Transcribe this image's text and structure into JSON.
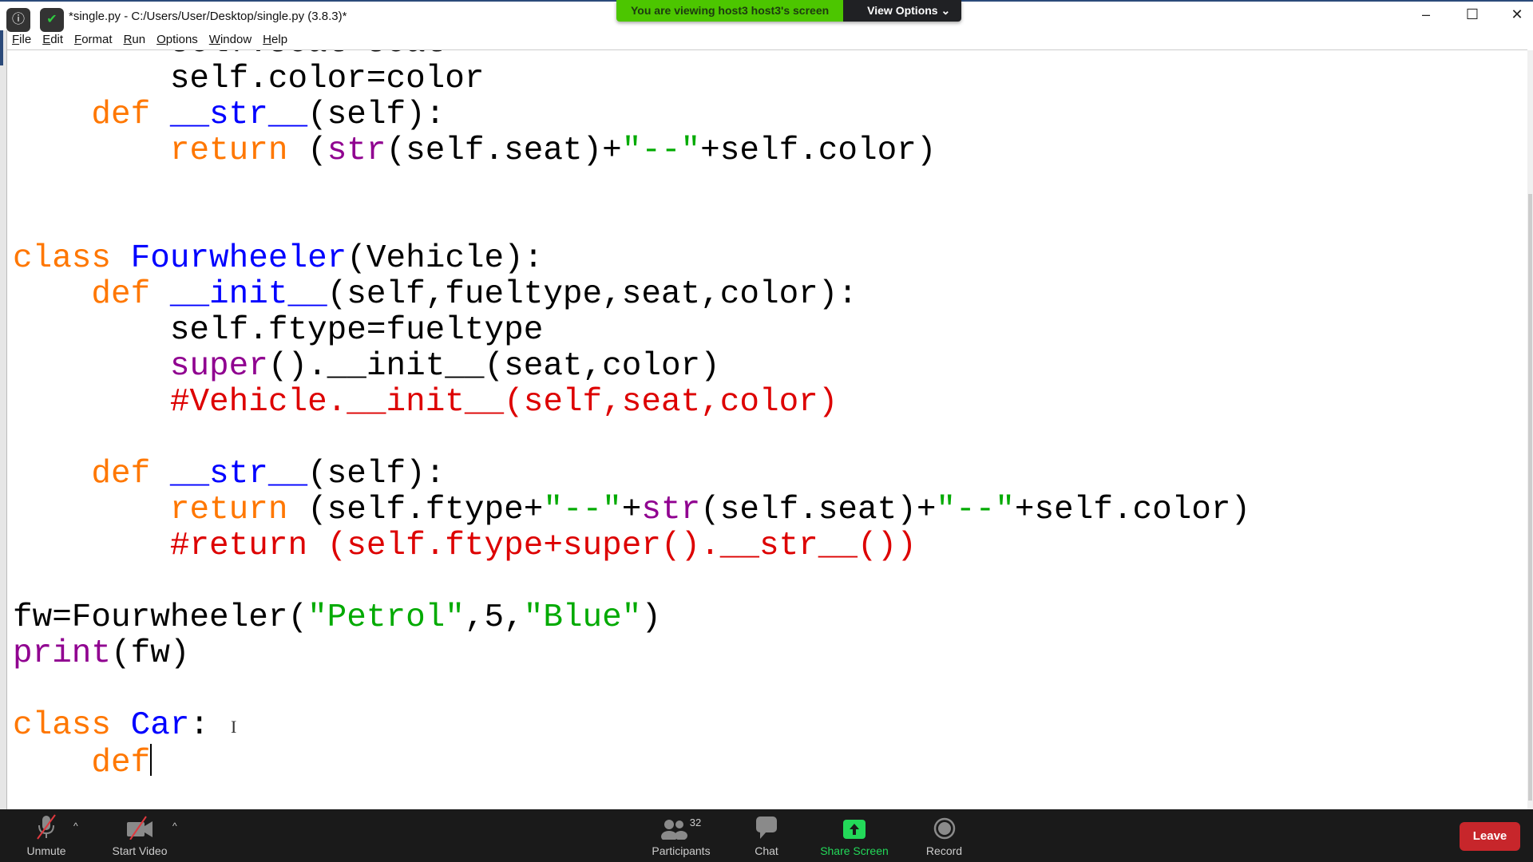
{
  "window": {
    "title": "*single.py - C:/Users/User/Desktop/single.py (3.8.3)*",
    "controls": {
      "minimize": "–",
      "maximize": "☐",
      "close": "✕"
    }
  },
  "banner": {
    "message": "You are viewing host3 host3's screen",
    "view_options": "View Options ⌄",
    "color": "#4cc600"
  },
  "menu": [
    "File",
    "Edit",
    "Format",
    "Run",
    "Options",
    "Window",
    "Help"
  ],
  "code": {
    "colors": {
      "keyword": "#ff7700",
      "builtin": "#900090",
      "string": "#00aa00",
      "comment": "#dd0000",
      "definition": "#0000ff"
    },
    "lines": [
      [
        [
          "",
          "        self.seat=seat"
        ]
      ],
      [
        [
          "",
          "        self.color=color"
        ]
      ],
      [
        [
          "",
          "    "
        ],
        [
          "kw",
          "def"
        ],
        [
          "",
          " "
        ],
        [
          "df",
          "__str__"
        ],
        [
          "",
          "(self):"
        ]
      ],
      [
        [
          "",
          "        "
        ],
        [
          "kw",
          "return"
        ],
        [
          "",
          " ("
        ],
        [
          "bi",
          "str"
        ],
        [
          "",
          "(self.seat)+"
        ],
        [
          "st",
          "\"--\""
        ],
        [
          "",
          "+self.color)"
        ]
      ],
      [],
      [],
      [
        [
          "kw",
          "class"
        ],
        [
          "",
          " "
        ],
        [
          "df",
          "Fourwheeler"
        ],
        [
          "",
          "(Vehicle):"
        ]
      ],
      [
        [
          "",
          "    "
        ],
        [
          "kw",
          "def"
        ],
        [
          "",
          " "
        ],
        [
          "df",
          "__init__"
        ],
        [
          "",
          "(self,fueltype,seat,color):"
        ]
      ],
      [
        [
          "",
          "        self.ftype=fueltype"
        ]
      ],
      [
        [
          "",
          "        "
        ],
        [
          "bi",
          "super"
        ],
        [
          "",
          "().__init__(seat,color)"
        ]
      ],
      [
        [
          "",
          "        "
        ],
        [
          "cm",
          "#Vehicle.__init__(self,seat,color)"
        ]
      ],
      [],
      [
        [
          "",
          "    "
        ],
        [
          "kw",
          "def"
        ],
        [
          "",
          " "
        ],
        [
          "df",
          "__str__"
        ],
        [
          "",
          "(self):"
        ]
      ],
      [
        [
          "",
          "        "
        ],
        [
          "kw",
          "return"
        ],
        [
          "",
          " (self.ftype+"
        ],
        [
          "st",
          "\"--\""
        ],
        [
          "",
          "+"
        ],
        [
          "bi",
          "str"
        ],
        [
          "",
          "(self.seat)+"
        ],
        [
          "st",
          "\"--\""
        ],
        [
          "",
          "+self.color)"
        ]
      ],
      [
        [
          "",
          "        "
        ],
        [
          "cm",
          "#return (self.ftype+super().__str__())"
        ]
      ],
      [],
      [
        [
          "",
          "fw=Fourwheeler("
        ],
        [
          "st",
          "\"Petrol\""
        ],
        [
          "",
          ",5,"
        ],
        [
          "st",
          "\"Blue\""
        ],
        [
          "",
          ")"
        ]
      ],
      [
        [
          "bi",
          "print"
        ],
        [
          "",
          "(fw)"
        ]
      ],
      [],
      [
        [
          "kw",
          "class"
        ],
        [
          "",
          " "
        ],
        [
          "df",
          "Car"
        ],
        [
          "",
          ":"
        ]
      ],
      [
        [
          "",
          "    "
        ],
        [
          "kw",
          "def"
        ]
      ]
    ]
  },
  "toolbar": {
    "unmute": "Unmute",
    "start_video": "Start Video",
    "participants": "Participants",
    "participants_count": "32",
    "chat": "Chat",
    "share_screen": "Share Screen",
    "record": "Record",
    "leave": "Leave",
    "leave_color": "#c7262b",
    "share_color": "#23d959"
  }
}
